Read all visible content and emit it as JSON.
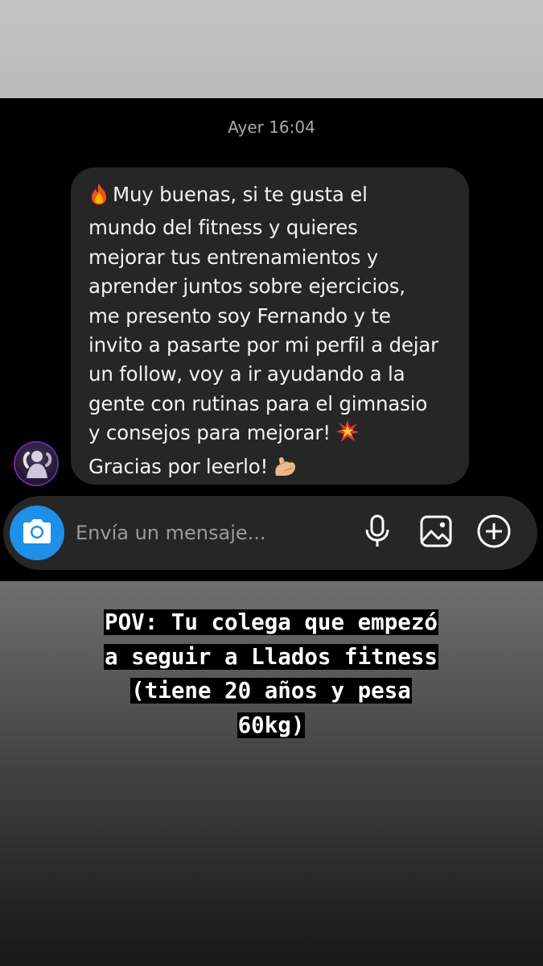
{
  "conversation": {
    "timestamp": "Ayer 16:04",
    "message": {
      "lines": [
        "Muy buenas, si te gusta el",
        "mundo del fitness y quieres",
        "mejorar tus entrenamientos y",
        "aprender juntos sobre ejercicios,",
        "me presento soy Fernando y te",
        "invito a pasarte por mi perfil a dejar",
        "un follow, voy a ir ayudando a la",
        "gente con rutinas para el gimnasio",
        "y consejos para mejorar!",
        "Gracias por leerlo!"
      ],
      "emojis": [
        "fire-emoji",
        "collision-emoji",
        "flexed-biceps-emoji"
      ]
    }
  },
  "composer": {
    "placeholder": "Envía un mensaje...",
    "value": "",
    "icons": [
      "camera-icon",
      "microphone-icon",
      "gallery-icon",
      "add-icon"
    ],
    "camera_color": "#1f8fe8"
  },
  "caption": {
    "lines": [
      "POV: Tu colega que empezó",
      "a seguir a Llados fitness",
      "(tiene 20 años y pesa",
      "60kg)"
    ]
  }
}
